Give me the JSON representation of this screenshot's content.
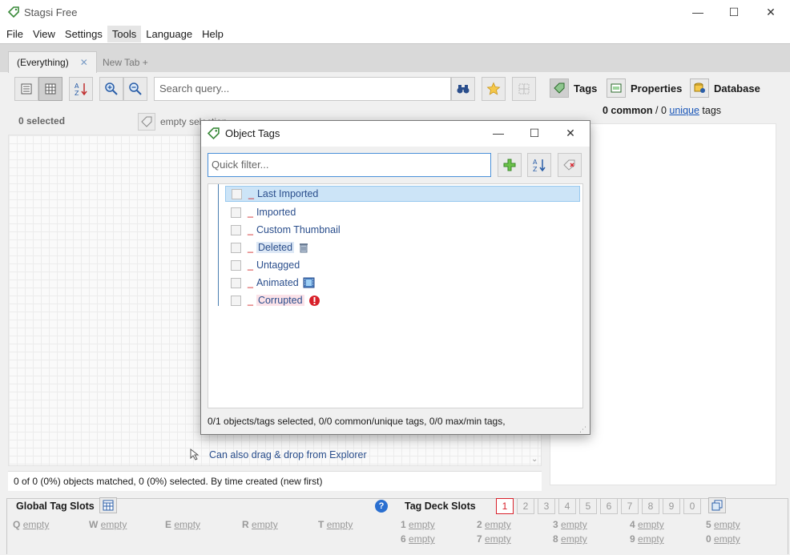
{
  "window": {
    "title": "Stagsi Free",
    "minimize": "—",
    "maximize": "☐",
    "close": "✕"
  },
  "menu": [
    "File",
    "View",
    "Settings",
    "Tools",
    "Language",
    "Help"
  ],
  "tabs": {
    "active": "(Everything)",
    "active_close": "✕",
    "new_tab": "New Tab +"
  },
  "search": {
    "placeholder": "Search query..."
  },
  "selection": {
    "count_label": "0 selected",
    "empty_label": "empty selection"
  },
  "right_panel": {
    "tabs": [
      "Tags",
      "Properties",
      "Database"
    ],
    "summary_prefix": "0 common",
    "summary_sep": "/ 0",
    "summary_link": "unique",
    "summary_suffix": "tags"
  },
  "drop_hint": "Can also drag & drop from Explorer",
  "status": "0 of 0 (0%) objects matched, 0 (0%) selected. By time created (new first)",
  "global_slots": {
    "label": "Global Tag Slots",
    "slots": [
      {
        "key": "Q",
        "value": "empty"
      },
      {
        "key": "W",
        "value": "empty"
      },
      {
        "key": "E",
        "value": "empty"
      },
      {
        "key": "R",
        "value": "empty"
      },
      {
        "key": "T",
        "value": "empty"
      }
    ]
  },
  "tag_deck": {
    "label": "Tag Deck Slots",
    "numbers": [
      "1",
      "2",
      "3",
      "4",
      "5",
      "6",
      "7",
      "8",
      "9",
      "0"
    ],
    "active_number": "1",
    "slots_row1": [
      {
        "key": "1",
        "value": "empty"
      },
      {
        "key": "2",
        "value": "empty"
      },
      {
        "key": "3",
        "value": "empty"
      },
      {
        "key": "4",
        "value": "empty"
      },
      {
        "key": "5",
        "value": "empty"
      }
    ],
    "slots_row2": [
      {
        "key": "6",
        "value": "empty"
      },
      {
        "key": "7",
        "value": "empty"
      },
      {
        "key": "8",
        "value": "empty"
      },
      {
        "key": "9",
        "value": "empty"
      },
      {
        "key": "0",
        "value": "empty"
      }
    ]
  },
  "dialog": {
    "title": "Object Tags",
    "filter_placeholder": "Quick filter...",
    "dash": "_",
    "tags": [
      {
        "label": "Last Imported",
        "selected": true
      },
      {
        "label": "Imported"
      },
      {
        "label": "Custom Thumbnail"
      },
      {
        "label": "Deleted",
        "icon": "trash-icon"
      },
      {
        "label": "Untagged"
      },
      {
        "label": "Animated",
        "icon": "film-icon"
      },
      {
        "label": "Corrupted",
        "icon": "error-icon"
      }
    ],
    "status": "0/1 objects/tags selected, 0/0 common/unique tags,  0/0 max/min tags,"
  },
  "colors": {
    "accent": "#2a4e8c",
    "link": "#1a56b8",
    "error": "#d8202a"
  }
}
